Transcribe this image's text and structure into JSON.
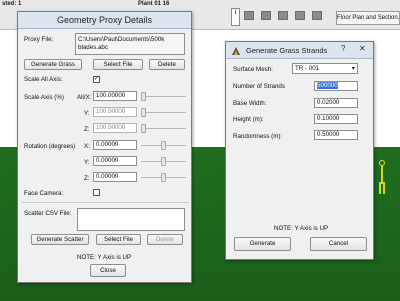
{
  "background": {
    "toolbar": {
      "left_text": "sted: 1",
      "plant_text": "Plant 01 16",
      "info_glyph": "i",
      "floor_button": "Floor Plan and Section..."
    },
    "toolbar_icons": [
      "toolbar-icon-1",
      "toolbar-icon-2",
      "toolbar-icon-3",
      "toolbar-icon-4",
      "toolbar-icon-5"
    ],
    "colors": {
      "ground": "#1f6e1f",
      "sky": "#ffffff"
    }
  },
  "proxy_dialog": {
    "title": "Geometry Proxy Details",
    "proxy_file_label": "Proxy File:",
    "proxy_file_value": "C:\\Users\\Paul\\Documents\\500k blades.abc",
    "generate_grass": "Generate Grass",
    "select_file": "Select File",
    "delete": "Delete",
    "scale_all_axis_label": "Scale All Axis:",
    "scale_all_axis_checked": true,
    "scale_axis_label": "Scale Axis (%)",
    "axis_all": "All/X:",
    "axis_y": "Y:",
    "axis_z": "Z:",
    "scale_x": "100.00000",
    "scale_y": "100.00000",
    "scale_z": "100.00000",
    "rotation_label": "Rotation (degrees)",
    "rot_x_label": "X:",
    "rot_y_label": "Y:",
    "rot_z_label": "Z:",
    "rot_x": "0.00000",
    "rot_y": "0.00000",
    "rot_z": "0.00000",
    "face_camera_label": "Face Camera:",
    "face_camera_checked": false,
    "scatter_label": "Scatter CSV File:",
    "scatter_value": "",
    "generate_scatter": "Generate Scatter",
    "select_file_2": "Select File",
    "delete_2": "Delete",
    "note": "NOTE: Y Axis is UP",
    "close": "Close"
  },
  "grass_dialog": {
    "title": "Generate Grass Strands",
    "help_glyph": "?",
    "close_glyph": "✕",
    "surface_mesh_label": "Surface Mesh:",
    "surface_mesh_value": "TR - 001",
    "strands_label": "Number of Strands",
    "strands_value": "500000",
    "base_width_label": "Base Width:",
    "base_width_value": "0.02000",
    "height_label": "Height (m):",
    "height_value": "0.10000",
    "randomness_label": "Randomness (m):",
    "randomness_value": "0.50000",
    "note": "NOTE: Y Axis is UP",
    "generate": "Generate",
    "cancel": "Cancel"
  }
}
